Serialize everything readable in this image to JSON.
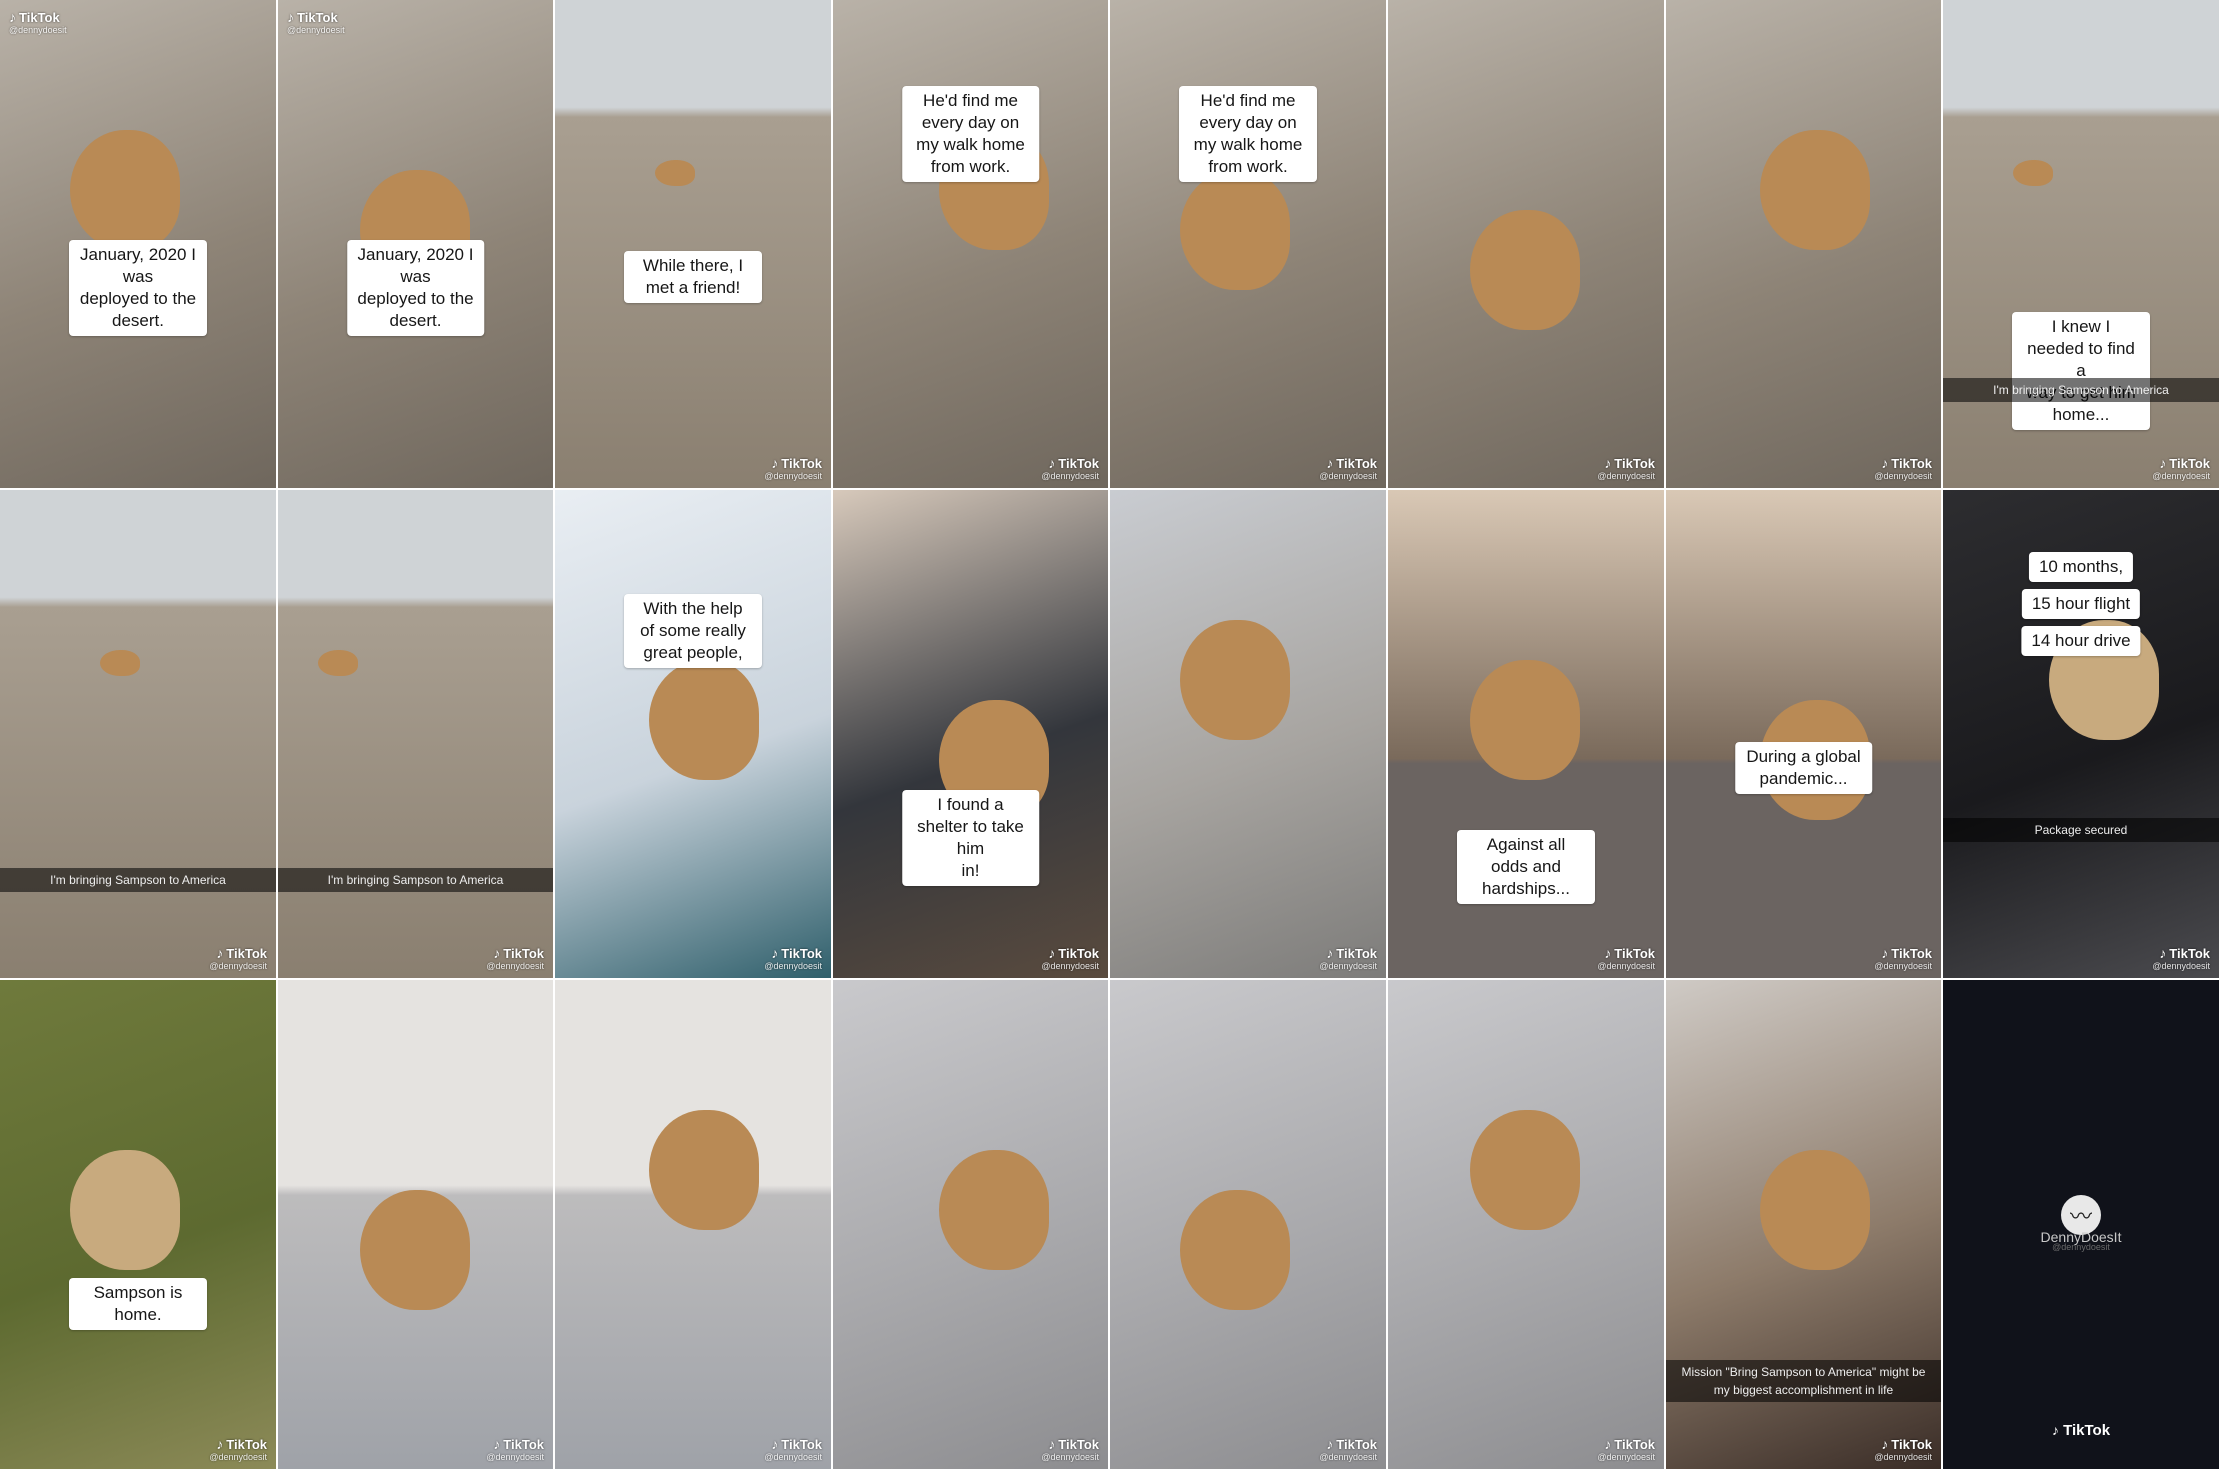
{
  "watermark": {
    "logo": "TikTok",
    "note": "♪",
    "username": "@dennydoesit"
  },
  "frames": [
    {
      "caption": "January, 2020 I was\ndeployed to the desert.",
      "scene": "desert-dog",
      "wm": "tl"
    },
    {
      "caption": "January, 2020 I was\ndeployed to the desert.",
      "scene": "desert-dog",
      "wm": "tl"
    },
    {
      "caption": "While there, I met a friend!",
      "scene": "desert-far",
      "wm": "br"
    },
    {
      "caption": "He'd find me every day on\nmy walk home from work.",
      "scene": "desert-dog",
      "wm": "br"
    },
    {
      "caption": "He'd find me every day on\nmy walk home from work.",
      "scene": "desert-dog",
      "wm": "br"
    },
    {
      "caption": "",
      "scene": "desert-dog",
      "wm": "br"
    },
    {
      "caption": "",
      "scene": "desert-dog",
      "wm": "br"
    },
    {
      "caption": "I knew I needed to find a\nway to get him home...",
      "snap": "I'm bringing Sampson to America",
      "scene": "desert-far",
      "wm": "br"
    },
    {
      "caption": "",
      "snap": "I'm bringing Sampson to America",
      "scene": "desert-far",
      "wm": "br"
    },
    {
      "caption": "",
      "snap": "I'm bringing Sampson to America",
      "scene": "desert-far",
      "wm": "br"
    },
    {
      "caption": "With the help of some really\ngreat people,",
      "scene": "indoor-light",
      "wm": "br"
    },
    {
      "caption": "I found a shelter to take him\nin!",
      "scene": "indoor-dark",
      "wm": "br"
    },
    {
      "caption": "",
      "scene": "shelter",
      "wm": "br"
    },
    {
      "caption": "Against all odds and\nhardships...",
      "scene": "balcony",
      "wm": "br"
    },
    {
      "caption": "During a global pandemic...",
      "scene": "balcony",
      "wm": "br"
    },
    {
      "captions": [
        "10 months,",
        "15 hour flight",
        "14 hour drive"
      ],
      "snap": "Package secured",
      "scene": "car",
      "wm": "br"
    },
    {
      "caption": "Sampson is home.",
      "scene": "grass",
      "wm": "br"
    },
    {
      "caption": "",
      "scene": "bedroom",
      "wm": "br"
    },
    {
      "caption": "",
      "scene": "bedroom",
      "wm": "br"
    },
    {
      "caption": "",
      "scene": "bed-dog",
      "wm": "br"
    },
    {
      "caption": "",
      "scene": "bed-dog",
      "wm": "br"
    },
    {
      "caption": "",
      "scene": "bed-dog",
      "wm": "br"
    },
    {
      "caption": "",
      "snap": "Mission \"Bring Sampson to America\" might be\nmy biggest accomplishment in life",
      "scene": "portrait",
      "wm": "br"
    },
    {
      "end": true,
      "name": "DennyDoesIt",
      "username": "@dennydoesit",
      "logo": "TikTok"
    }
  ]
}
